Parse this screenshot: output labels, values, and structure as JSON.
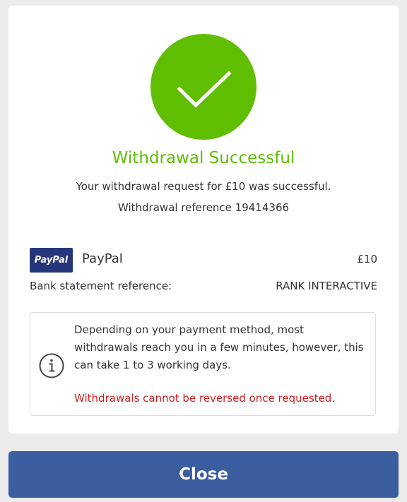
{
  "status": {
    "icon": "checkmark-icon",
    "title": "Withdrawal Successful",
    "message": "Your withdrawal request for £10 was successful.",
    "reference": "Withdrawal reference 19414366"
  },
  "payment": {
    "logo_text": "PayPal",
    "method_name": "PayPal",
    "amount": "£10",
    "statement_label": "Bank statement reference:",
    "statement_value": "RANK INTERACTIVE"
  },
  "info": {
    "icon": "info-icon",
    "text": "Depending on your payment method, most withdrawals reach you in a few minutes, however, this can take 1 to 3 working days.",
    "warning": "Withdrawals cannot be reversed once requested."
  },
  "actions": {
    "close_label": "Close"
  },
  "colors": {
    "success": "#5fbe00",
    "button": "#3b5ea0",
    "warning": "#cc1f1f",
    "paypal": "#26367a"
  }
}
